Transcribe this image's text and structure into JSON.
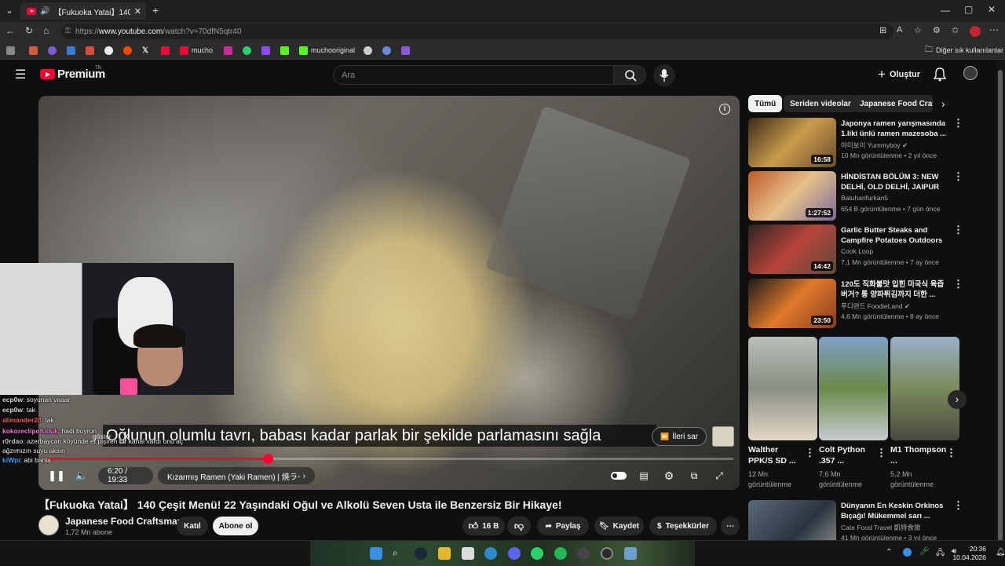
{
  "browser": {
    "tab_title": "【Fukuoka Yatai】140 Çeşit Me",
    "url_prefix": "https://",
    "url_host": "www.youtube.com",
    "url_path": "/watch?v=70dfN5qtr40",
    "bookmarks": [
      "mucho",
      "muchooriginal"
    ],
    "other_bookmarks": "Diğer sık kullanılanlar"
  },
  "youtube": {
    "logo_text": "Premium",
    "logo_region": "TR",
    "search_placeholder": "Ara",
    "create_label": "Oluştur"
  },
  "player": {
    "subtitle": "Oğlunun olumlu tavrı, babası kadar parlak bir şekilde parlamasını sağla",
    "skip_label": "İleri sar",
    "time": "6:20 / 19:33",
    "chapter": "Kızarmış Ramen (Yaki Ramen) | 焼ラーメン",
    "progress_fraction": 0.324,
    "show_label": "göster"
  },
  "chat": [
    {
      "user": "ecp0w",
      "text": ": soyunan vaaar",
      "color": "#d9d9d9"
    },
    {
      "user": "ecp0w",
      "text": ": tak",
      "color": "#d9d9d9"
    },
    {
      "user": "alimander28",
      "text": ": tak",
      "color": "#ff5a5a"
    },
    {
      "user": "kokoreclipofuduk",
      "text": ": hadi buyrun",
      "color": "#ff6fd8"
    },
    {
      "user": "r0rdao",
      "text": ": azerbaycan köyünde et pişiren bir kanal vardı onu aç ağzımızın suyu aksın",
      "color": "#c6c6c6"
    },
    {
      "user": "kiWpi",
      "text": ": abi banla",
      "color": "#3aa0ff"
    }
  ],
  "video": {
    "title": "【Fukuoka Yatai】 140 Çeşit Menü! 22 Yaşındaki Oğul ve Alkolü Seven Usta ile Benzersiz Bir Hikaye!",
    "channel": "Japanese Food Craftsman",
    "subscribers": "1,72 Mn abone",
    "join_label": "Katıl",
    "subscribe_label": "Abone ol",
    "likes": "16 B",
    "share_label": "Paylaş",
    "save_label": "Kaydet",
    "thanks_label": "Teşekkürler"
  },
  "chips": [
    "Tümü",
    "Seriden videolar",
    "Japanese Food Crafts"
  ],
  "recommendations": [
    {
      "title": "Japonya ramen yarışmasında 1.liki ünlü ramen mazesoba ...",
      "channel": "야미보이 Yummyboy",
      "verified": true,
      "meta": "10 Mn görüntülenme • 2 yıl önce",
      "duration": "16:58",
      "colors": [
        "#3a2a1a",
        "#c99c4a",
        "#6a4a2a"
      ]
    },
    {
      "title": "HİNDİSTAN BÖLÜM 3: NEW DELHİ, OLD DELHİ, JAIPUR 🇮🇳",
      "channel": "Batuhanfurkan5",
      "verified": false,
      "meta": "654 B görüntülenme • 7 gün önce",
      "duration": "1:27:52",
      "colors": [
        "#c05a2a",
        "#e6c08a",
        "#7a6a9a"
      ]
    },
    {
      "title": "Garlic Butter Steaks and Campfire Potatoes Outdoors",
      "channel": "Cook Loop",
      "verified": false,
      "meta": "7,1 Mn görüntülenme • 7 ay önce",
      "duration": "14:42",
      "colors": [
        "#2a2422",
        "#b8443a",
        "#5a4a3a"
      ]
    },
    {
      "title": "120도 직화불맛 입힌 미국식 육즙버거? 통 양파튀김까지 더한 ...",
      "channel": "푸디랜드 FoodieLand",
      "verified": true,
      "meta": "4,6 Mn görüntülenme • 8 ay önce",
      "duration": "23:50",
      "colors": [
        "#1a1a1a",
        "#e07a2a",
        "#8a3a1a"
      ]
    }
  ],
  "shorts": [
    {
      "title": "Walther PPK/S SD ...",
      "views": "12 Mn görüntülenme",
      "colors": [
        "#b9c0b8",
        "#8a8f84",
        "#e3d8c7"
      ]
    },
    {
      "title": "Colt Python .357 ...",
      "views": "7,6 Mn görüntülenme",
      "colors": [
        "#7fa0c8",
        "#6a8a4a",
        "#c7ccd0"
      ]
    },
    {
      "title": "M1 Thompson ...",
      "views": "5,2 Mn görüntülenme",
      "colors": [
        "#9ab0c8",
        "#7a8a5a",
        "#4a4a40"
      ]
    }
  ],
  "last_rec": {
    "title": "Dünyanın En Keskin Orkinos Bıçağı!  Mükemmel sarı ...",
    "channel": "Cate Food Travel 凱特食旅",
    "meta": "41 Mn görüntülenme • 3 yıl önce"
  },
  "taskbar": {
    "time": "20:36",
    "date": "10.04.2026"
  },
  "colors": {
    "accent": "#ff0033",
    "background": "#0f0f0f"
  }
}
